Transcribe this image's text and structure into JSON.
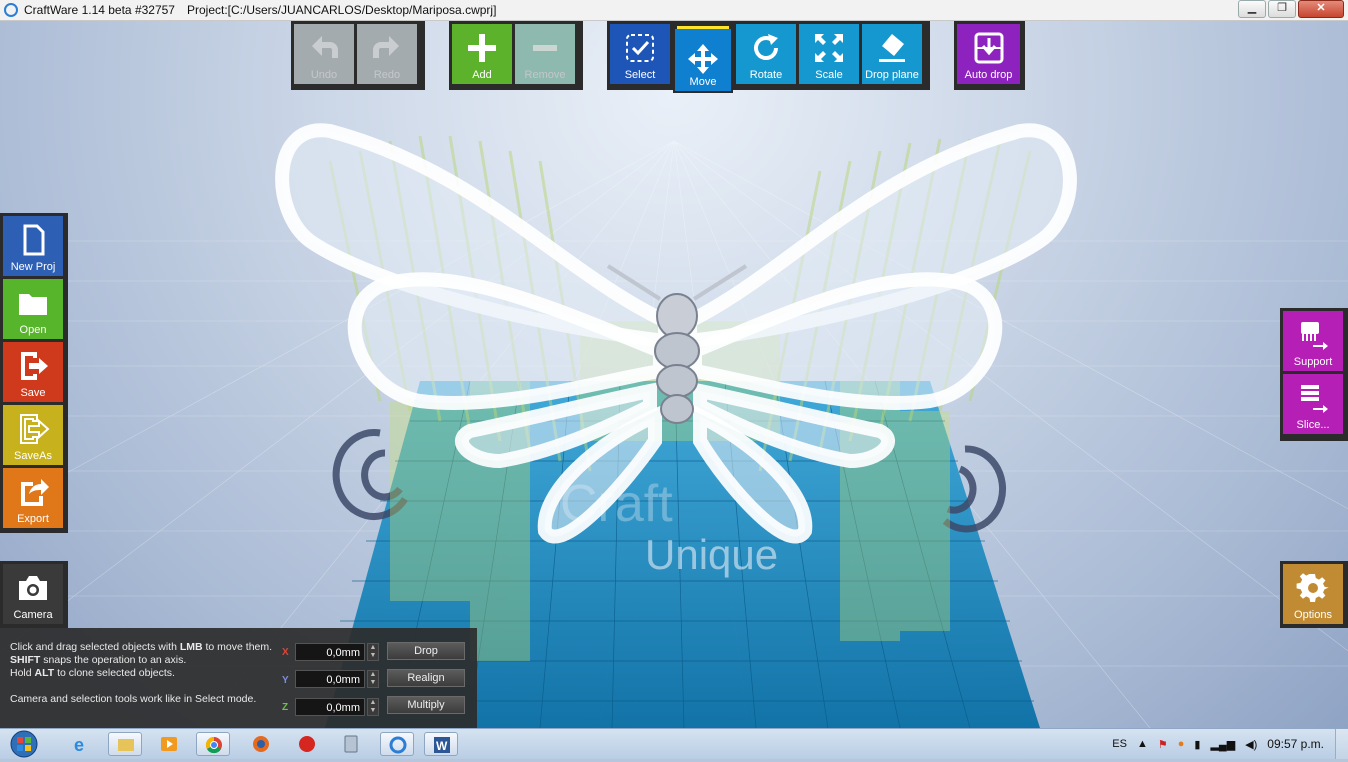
{
  "titlebar": {
    "app": "CraftWare 1.14 beta #32757",
    "project": "Project:[C:/Users/JUANCARLOS/Desktop/Mariposa.cwprj]"
  },
  "window_buttons": {
    "minimize": "▁",
    "restore": "❐",
    "close": "✕"
  },
  "toolbar": {
    "undo": "Undo",
    "redo": "Redo",
    "add": "Add",
    "remove": "Remove",
    "select": "Select",
    "move": "Move",
    "rotate": "Rotate",
    "scale": "Scale",
    "drop_plane": "Drop plane",
    "auto_drop": "Auto drop"
  },
  "left_menu": {
    "new_proj": "New Proj",
    "open": "Open",
    "save": "Save",
    "saveas": "SaveAs",
    "export": "Export",
    "camera": "Camera"
  },
  "right_menu": {
    "support": "Support",
    "slice": "Slice...",
    "options": "Options"
  },
  "help": {
    "line1_a": "Click and drag selected objects with ",
    "line1_b": "LMB",
    "line1_c": " to move them.",
    "line2_a": "SHIFT",
    "line2_b": " snaps the operation to an axis.",
    "line3_a": "Hold ",
    "line3_b": "ALT",
    "line3_c": " to clone selected objects.",
    "line4": "Camera and selection tools work like in Select mode."
  },
  "move_panel": {
    "x_label": "X",
    "y_label": "Y",
    "z_label": "Z",
    "x_value": "0,0mm",
    "y_value": "0,0mm",
    "z_value": "0,0mm",
    "drop": "Drop",
    "realign": "Realign",
    "multiply": "Multiply"
  },
  "scene": {
    "bed_logo_text": "Unique",
    "bed_logo_text2": "Craft"
  },
  "tray": {
    "language": "ES",
    "clock": "09:57 p.m."
  },
  "colors": {
    "undo": "#b9c2c7",
    "add": "#5db22b",
    "remove": "#9fd2c6",
    "select": "#1e56b8",
    "move": "#0f7fcf",
    "rotate": "#1598cf",
    "scale": "#1598cf",
    "drop_plane": "#1598cf",
    "auto_drop": "#8d22bf",
    "new_proj": "#2d5fb4",
    "open": "#57b52b",
    "save": "#d03a1c",
    "saveas": "#c7b21d",
    "export": "#e0781a",
    "camera": "#3a3a3a",
    "support": "#b51fb5",
    "options": "#c08b33"
  }
}
